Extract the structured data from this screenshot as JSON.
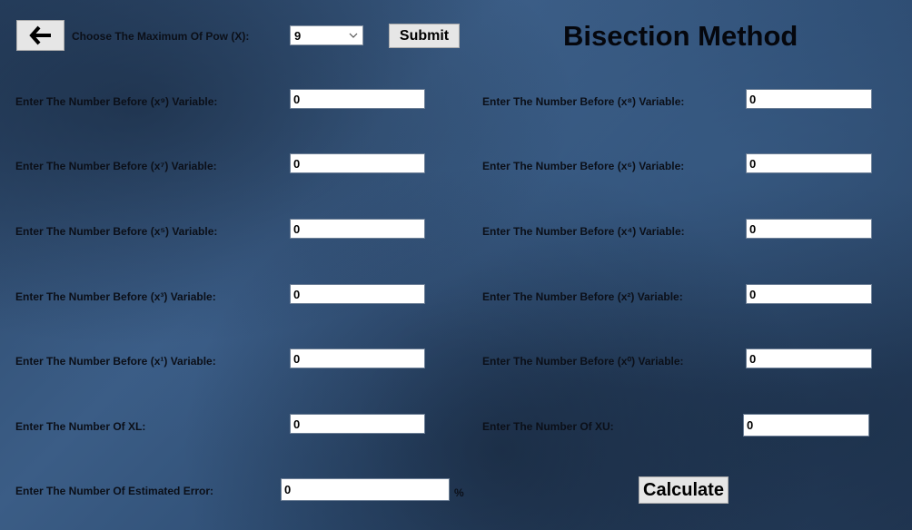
{
  "header": {
    "back_icon": "arrow-left-icon",
    "pow_label": "Choose The Maximum Of Pow (X):",
    "pow_selected": "9",
    "submit_label": "Submit",
    "title": "Bisection Method"
  },
  "coefficients": {
    "x9_label": "Enter The Number Before (x⁹) Variable:",
    "x9_value": "0",
    "x8_label": "Enter The Number Before (x⁸) Variable:",
    "x8_value": "0",
    "x7_label": "Enter The Number Before (x⁷) Variable:",
    "x7_value": "0",
    "x6_label": "Enter The Number Before (x⁶) Variable:",
    "x6_value": "0",
    "x5_label": "Enter The Number Before (x⁵) Variable:",
    "x5_value": "0",
    "x4_label": "Enter The Number Before (x⁴) Variable:",
    "x4_value": "0",
    "x3_label": "Enter The Number Before (x³) Variable:",
    "x3_value": "0",
    "x2_label": "Enter The Number Before (x²) Variable:",
    "x2_value": "0",
    "x1_label": "Enter The Number Before (x¹) Variable:",
    "x1_value": "0",
    "x0_label": "Enter The Number Before (x⁰) Variable:",
    "x0_value": "0"
  },
  "bounds": {
    "xl_label": "Enter The Number Of  XL:",
    "xl_value": "0",
    "xu_label": "Enter The Number Of  XU:",
    "xu_value": "0"
  },
  "error": {
    "label": "Enter The Number Of Estimated Error:",
    "value": "0",
    "unit": "%"
  },
  "calculate_label": "Calculate"
}
